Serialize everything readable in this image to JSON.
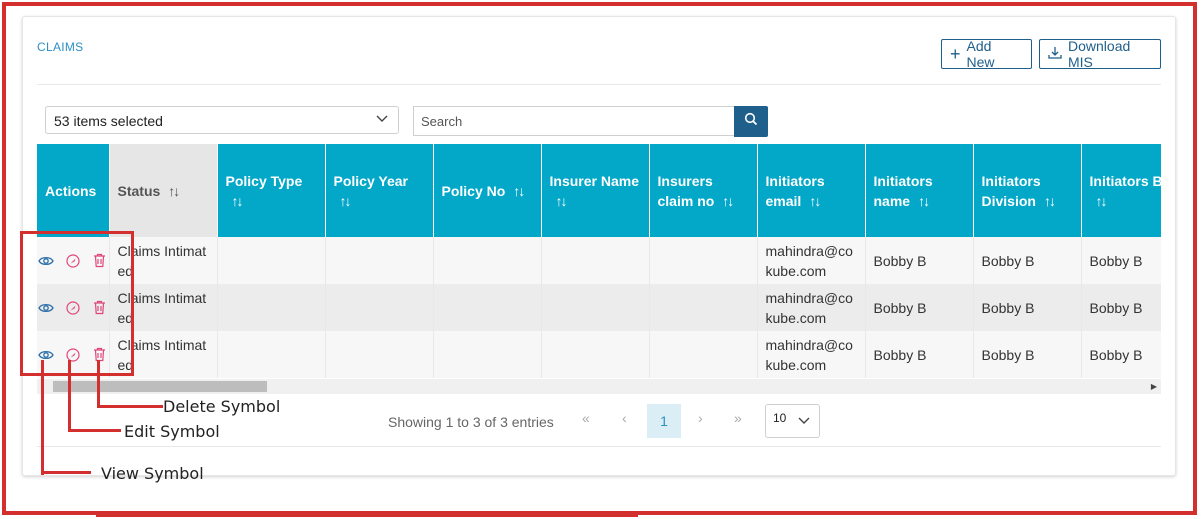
{
  "page": {
    "title": "CLAIMS"
  },
  "toolbar": {
    "add_new_label": "Add New",
    "download_label": "Download MIS"
  },
  "filters": {
    "selection_label": "53 items selected",
    "search_placeholder": "Search"
  },
  "table": {
    "columns": [
      "Actions",
      "Status",
      "Policy Type",
      "Policy Year",
      "Policy No",
      "Insurer Name",
      "Insurers claim no",
      "Initiators email",
      "Initiators name",
      "Initiators Division",
      "Initiators Bl"
    ],
    "sort_symbol": "↑↓",
    "rows": [
      {
        "status": "Claims Intimated",
        "policy_type": "",
        "policy_year": "",
        "policy_no": "",
        "insurer_name": "",
        "insurers_claim_no": "",
        "email": "mahindra@cokube.com",
        "name": "Bobby B",
        "division": "Bobby B",
        "bl": "Bobby B"
      },
      {
        "status": "Claims Intimated",
        "policy_type": "",
        "policy_year": "",
        "policy_no": "",
        "insurer_name": "",
        "insurers_claim_no": "",
        "email": "mahindra@cokube.com",
        "name": "Bobby B",
        "division": "Bobby B",
        "bl": "Bobby B"
      },
      {
        "status": "Claims Intimated",
        "policy_type": "",
        "policy_year": "",
        "policy_no": "",
        "insurer_name": "",
        "insurers_claim_no": "",
        "email": "mahindra@cokube.com",
        "name": "Bobby B",
        "division": "Bobby B",
        "bl": "Bobby B"
      }
    ]
  },
  "pagination": {
    "summary": "Showing 1 to 3 of 3 entries",
    "first": "«",
    "prev": "‹",
    "current_page": "1",
    "next": "›",
    "last": "»",
    "page_size": "10"
  },
  "annotations": {
    "delete": "Delete Symbol",
    "edit": "Edit Symbol",
    "view": "View Symbol"
  },
  "colors": {
    "header_bg": "#03a7c7",
    "primary": "#1f5f8b",
    "annotation_red": "#d32f2f",
    "action_icon_pink": "#e0457b",
    "view_icon_blue": "#2d6fa8"
  },
  "icons": {
    "view": "eye-icon",
    "edit": "compass-icon",
    "delete": "trash-icon",
    "search": "search-icon",
    "download": "download-icon",
    "add": "plus-icon"
  }
}
